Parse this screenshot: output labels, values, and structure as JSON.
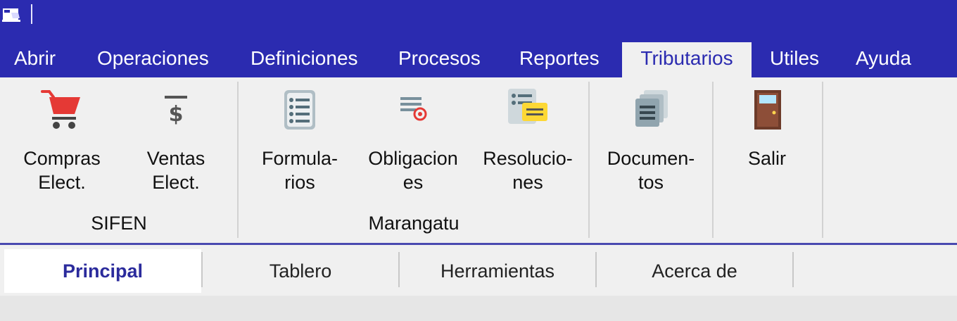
{
  "colors": {
    "brand": "#2b2bb0",
    "ribbon_bg": "#f0f0f0",
    "active_tab_text": "#2b2b9c"
  },
  "menu": {
    "items": [
      {
        "label": "Abrir"
      },
      {
        "label": "Operaciones"
      },
      {
        "label": "Definiciones"
      },
      {
        "label": "Procesos"
      },
      {
        "label": "Reportes"
      },
      {
        "label": "Tributarios",
        "active": true
      },
      {
        "label": "Utiles"
      },
      {
        "label": "Ayuda"
      }
    ]
  },
  "ribbon": {
    "groups": [
      {
        "label": "SIFEN",
        "buttons": [
          {
            "line1": "Compras",
            "line2": "Elect.",
            "icon": "shopping-cart-icon"
          },
          {
            "line1": "Ventas",
            "line2": "Elect.",
            "icon": "dollar-document-icon"
          }
        ]
      },
      {
        "label": "Marangatu",
        "buttons": [
          {
            "line1": "Formula-",
            "line2": "rios",
            "icon": "list-form-icon"
          },
          {
            "line1": "Obligacion",
            "line2": "es",
            "icon": "obligation-icon"
          },
          {
            "line1": "Resolucio-",
            "line2": "nes",
            "icon": "resolution-icon"
          }
        ]
      },
      {
        "label": "",
        "buttons": [
          {
            "line1": "Documen-",
            "line2": "tos",
            "icon": "documents-icon"
          }
        ]
      },
      {
        "label": "",
        "buttons": [
          {
            "line1": "Salir",
            "line2": "",
            "icon": "exit-door-icon"
          }
        ]
      }
    ]
  },
  "bottom_tabs": [
    {
      "label": "Principal",
      "active": true
    },
    {
      "label": "Tablero"
    },
    {
      "label": "Herramientas"
    },
    {
      "label": "Acerca de"
    }
  ]
}
